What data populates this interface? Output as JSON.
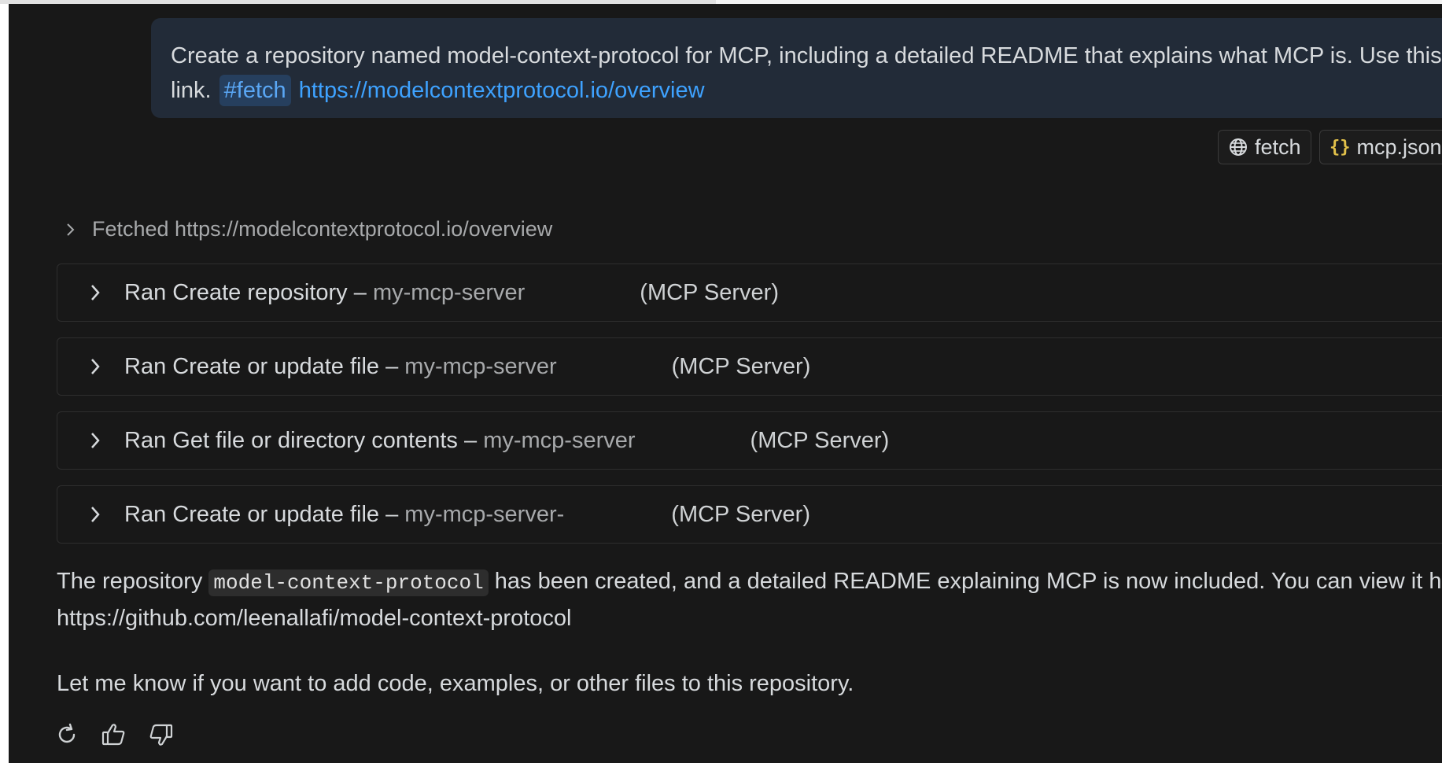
{
  "user_message": {
    "line1": "Create a repository named model-context-protocol for MCP, including a detailed README that explains what MCP is. Use this",
    "line2_prefix": "link.",
    "fetch_tag": "#fetch",
    "link": "https://modelcontextprotocol.io/overview"
  },
  "references": [
    {
      "label": "fetch",
      "icon": "globe-icon"
    },
    {
      "label": "mcp.json",
      "icon": "braces-icon"
    }
  ],
  "fetched": {
    "label": "Fetched https://modelcontextprotocol.io/overview"
  },
  "tool_calls": [
    {
      "action": "Ran Create repository",
      "sep": "–",
      "server": "my-mcp-server",
      "tag": "(MCP Server)"
    },
    {
      "action": "Ran Create or update file",
      "sep": "–",
      "server": "my-mcp-server",
      "tag": "(MCP Server)"
    },
    {
      "action": "Ran Get file or directory contents",
      "sep": "–",
      "server": "my-mcp-server",
      "tag": "(MCP Server)"
    },
    {
      "action": "Ran Create or update file",
      "sep": "–",
      "server": "my-mcp-server-",
      "tag": "(MCP Server)"
    }
  ],
  "response": {
    "p1_before": "The repository",
    "repo_code": "model-context-protocol",
    "p1_after": "has been created, and a detailed README explaining MCP is now included. You can view it here",
    "repo_link": "https://github.com/leenallafi/model-context-protocol",
    "p2": "Let me know if you want to add code, examples, or other files to this repository."
  },
  "actions": [
    {
      "name": "retry-icon"
    },
    {
      "name": "thumbs-up-icon"
    },
    {
      "name": "thumbs-down-icon"
    }
  ],
  "colors": {
    "background": "#181818",
    "user_bubble": "#222b38",
    "link": "#3ea2ff",
    "text": "#d7dadd",
    "muted": "#a7a9ab"
  }
}
